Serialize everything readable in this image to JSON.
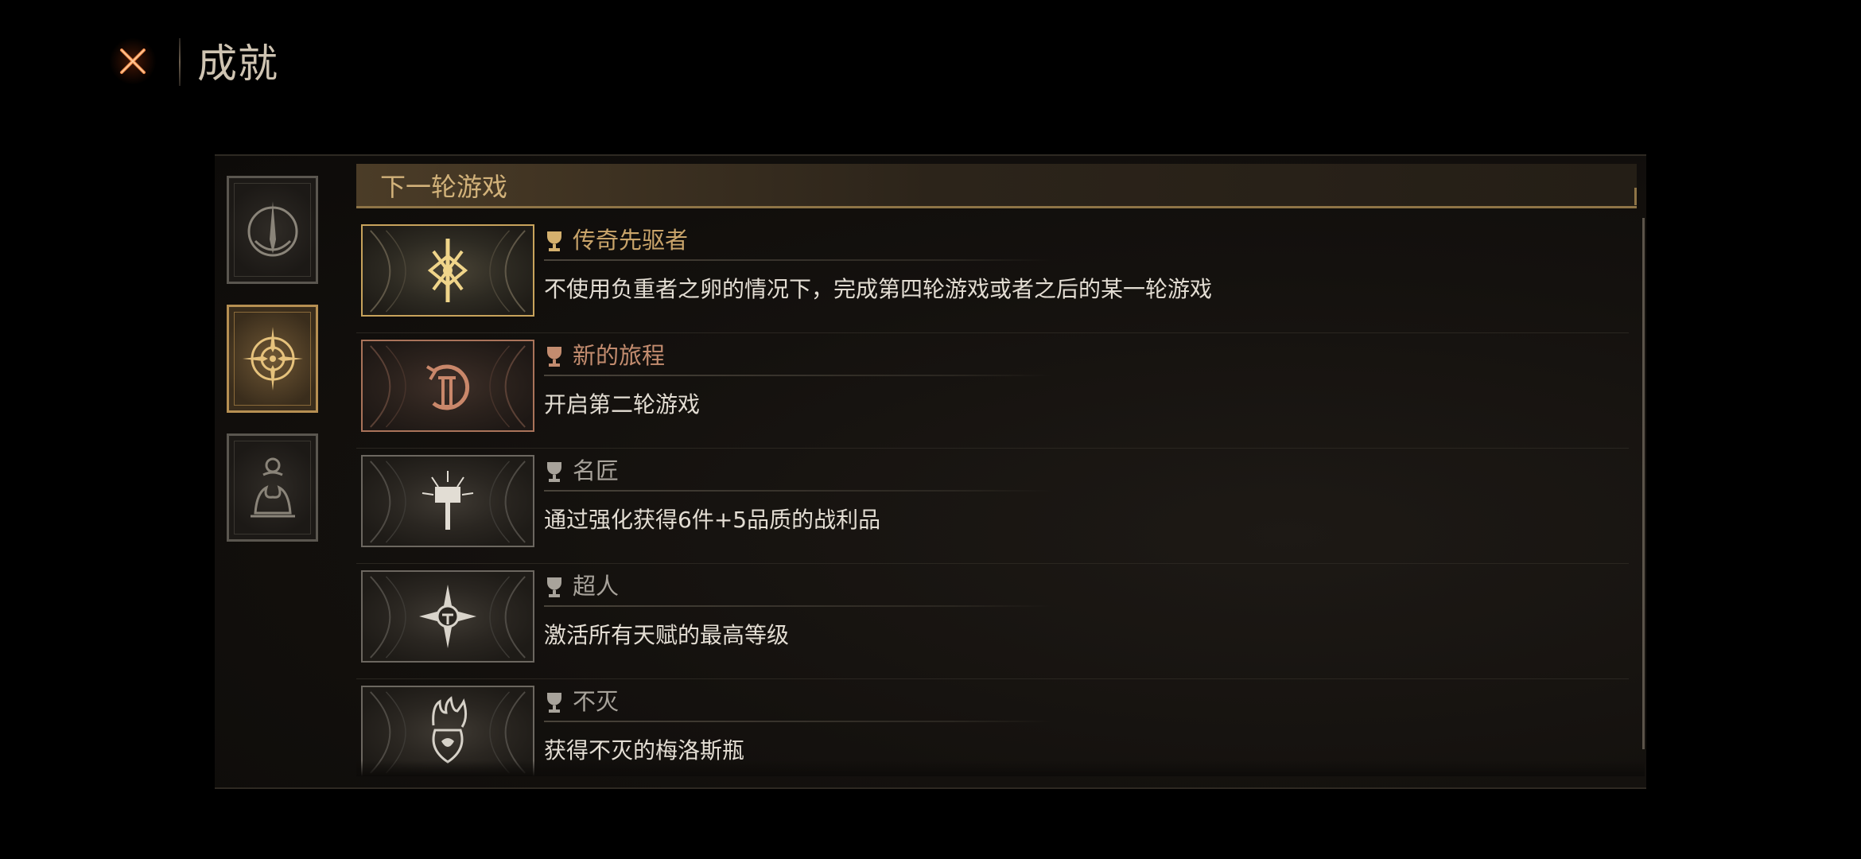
{
  "header": {
    "title": "成就",
    "close_icon": "close-x-icon"
  },
  "categories": [
    {
      "icon": "spire-rune-icon",
      "active": false
    },
    {
      "icon": "compass-sun-icon",
      "active": true
    },
    {
      "icon": "flame-altar-icon",
      "active": false
    }
  ],
  "section": {
    "title": "下一轮游戏"
  },
  "achievements": [
    {
      "name": "传奇先驱者",
      "description": "不使用负重者之卵的情况下，完成第四轮游戏或者之后的某一轮游戏",
      "tier": "gold",
      "icon": "rune-sigil-icon"
    },
    {
      "name": "新的旅程",
      "description": "开启第二轮游戏",
      "tier": "bronze",
      "icon": "cycle-two-icon"
    },
    {
      "name": "名匠",
      "description": "通过强化获得6件+5品质的战利品",
      "tier": "silver",
      "icon": "radiant-hammer-icon"
    },
    {
      "name": "超人",
      "description": "激活所有天赋的最高等级",
      "tier": "silver",
      "icon": "star-compass-icon"
    },
    {
      "name": "不灭",
      "description": "获得不灭的梅洛斯瓶",
      "tier": "silver",
      "icon": "flame-flask-icon"
    }
  ],
  "colors": {
    "gold": "#c9a46a",
    "bronze": "#c38c6f",
    "silver": "#a8a39b",
    "accent_close": "#e0703a"
  }
}
